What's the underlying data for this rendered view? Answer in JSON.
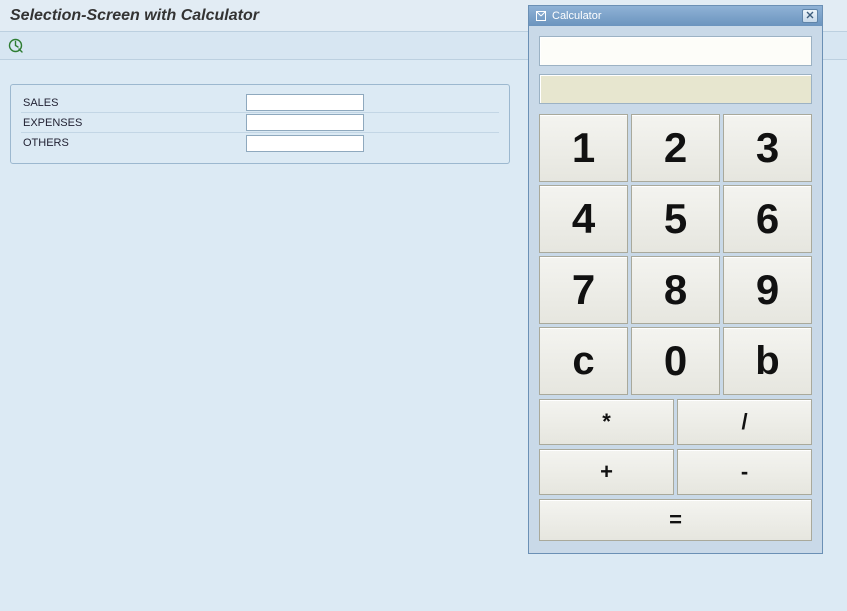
{
  "header": {
    "title": "Selection-Screen with Calculator"
  },
  "form": {
    "rows": [
      {
        "label": "SALES",
        "value": ""
      },
      {
        "label": "EXPENSES",
        "value": ""
      },
      {
        "label": "OTHERS",
        "value": ""
      }
    ]
  },
  "calculator": {
    "title": "Calculator",
    "display_primary": "",
    "display_secondary": "",
    "keys_grid": [
      "1",
      "2",
      "3",
      "4",
      "5",
      "6",
      "7",
      "8",
      "9",
      "c",
      "0",
      "b"
    ],
    "ops": [
      "*",
      "/",
      "+",
      "-"
    ],
    "equals": "="
  }
}
